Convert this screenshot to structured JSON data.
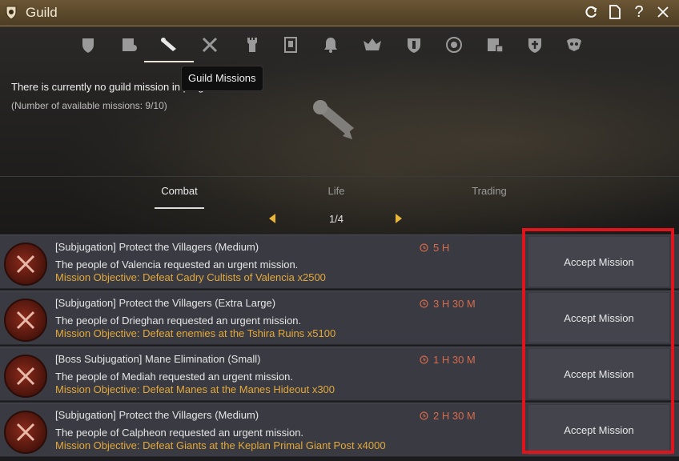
{
  "window": {
    "title": "Guild"
  },
  "tabs": {
    "icons": [
      "guild-crest-icon",
      "guild-members-icon",
      "guild-missions-icon",
      "guild-skills-icon",
      "guild-castle-icon",
      "guild-notice-icon",
      "guild-alarm-icon",
      "guild-war-icon",
      "guild-shield-icon",
      "guild-emblem-icon",
      "guild-house-icon",
      "guild-cross-icon",
      "guild-pet-icon"
    ],
    "tooltip": "Guild Missions"
  },
  "status": {
    "line1": "There is currently no guild mission in progress.",
    "line2": "(Number of available missions: 9/10)"
  },
  "categories": [
    "Combat",
    "Life",
    "Trading"
  ],
  "pager": {
    "page": "1/4"
  },
  "missions": [
    {
      "title": "[Subjugation] Protect the Villagers (Medium)",
      "time": "5 H",
      "description": "The people of Valencia requested an urgent mission.",
      "objective": "Mission Objective: Defeat Cadry Cultists of Valencia x2500",
      "action": "Accept Mission"
    },
    {
      "title": "[Subjugation] Protect the Villagers (Extra Large)",
      "time": "3 H 30 M",
      "description": "The people of Drieghan requested an urgent mission.",
      "objective": "Mission Objective: Defeat enemies at the Tshira Ruins x5100",
      "action": "Accept Mission"
    },
    {
      "title": "[Boss Subjugation] Mane Elimination (Small)",
      "time": "1 H 30 M",
      "description": "The people of Mediah requested an urgent mission.",
      "objective": "Mission Objective: Defeat Manes at the Manes Hideout x300",
      "action": "Accept Mission"
    },
    {
      "title": "[Subjugation] Protect the Villagers (Medium)",
      "time": "2 H 30 M",
      "description": "The people of Calpheon requested an urgent mission.",
      "objective": "Mission Objective: Defeat Giants at the Keplan Primal Giant Post x4000",
      "action": "Accept Mission"
    }
  ],
  "colors": {
    "accent": "#e3a93c",
    "timer": "#d76b4e",
    "highlight": "#e0141c",
    "titlebar": "#5c4a2c"
  }
}
